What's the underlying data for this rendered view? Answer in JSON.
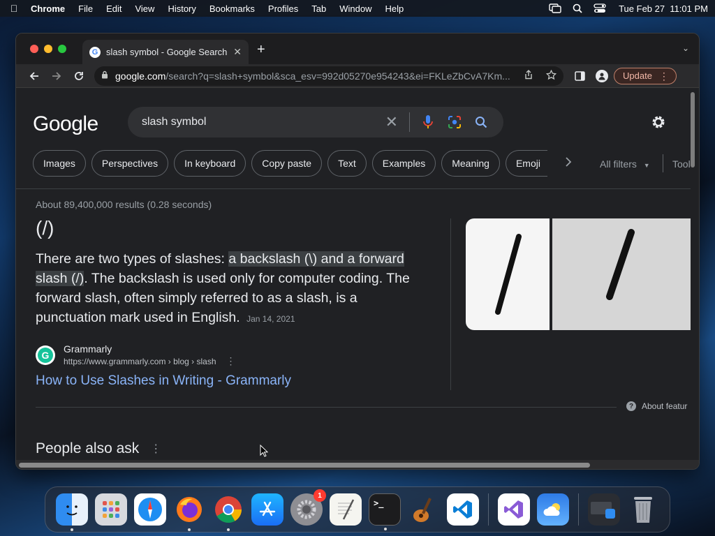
{
  "menubar": {
    "app": "Chrome",
    "items": [
      "File",
      "Edit",
      "View",
      "History",
      "Bookmarks",
      "Profiles",
      "Tab",
      "Window",
      "Help"
    ],
    "clock": "Tue Feb 27  11:01 PM"
  },
  "browser": {
    "tab_title": "slash symbol - Google Search",
    "url_host": "google.com",
    "url_path": "/search?q=slash+symbol&sca_esv=992d05270e954243&ei=FKLeZbCvA7Km...",
    "update_label": "Update"
  },
  "search": {
    "logo": "Google",
    "query": "slash symbol",
    "chips": [
      "Images",
      "Perspectives",
      "In keyboard",
      "Copy paste",
      "Text",
      "Examples",
      "Meaning",
      "Emoji"
    ],
    "all_filters": "All filters",
    "tools": "Tool"
  },
  "result": {
    "stats": "About 89,400,000 results (0.28 seconds)",
    "answer_title": "(/)",
    "snippet_pre": "There are two types of slashes: ",
    "snippet_highlight": "a backslash (\\) and a forward slash (/)",
    "snippet_post": ". The backslash is used only for computer coding. The forward slash, often simply referred to as a slash, is a punctuation mark used in English.",
    "date": "Jan 14, 2021",
    "source_name": "Grammarly",
    "source_url": "https://www.grammarly.com › blog › slash",
    "link_title": "How to Use Slashes in Writing - Grammarly",
    "about_featured": "About featur",
    "people_also_ask": "People also ask"
  },
  "dock": {
    "items": [
      "finder-icon",
      "launchpad-icon",
      "safari-icon",
      "firefox-icon",
      "chrome-icon",
      "app-store-icon",
      "system-settings-icon",
      "textedit-icon",
      "terminal-icon",
      "garageband-icon",
      "vscode-icon",
      "visual-studio-icon",
      "weather-icon",
      "screenshot-icon",
      "trash-icon"
    ],
    "settings_badge": "1"
  },
  "colors": {
    "page_bg": "#202124",
    "link": "#8ab4f8",
    "accent_update": "#f2b8a8"
  }
}
